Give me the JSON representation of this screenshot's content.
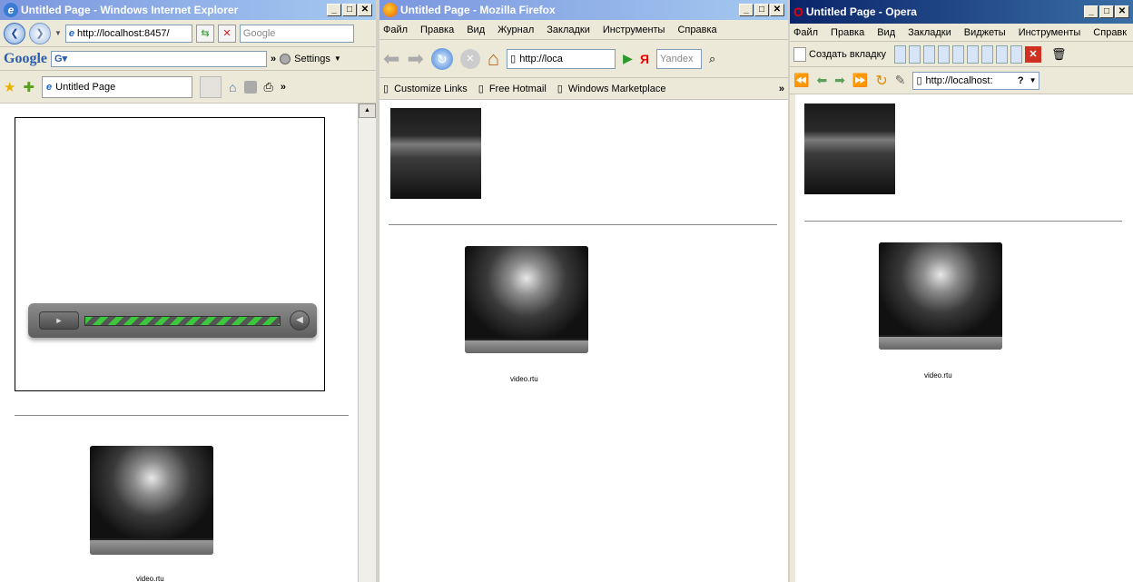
{
  "ie": {
    "title": "Untitled Page - Windows Internet Explorer",
    "address": "http://localhost:8457/",
    "search_placeholder": "Google",
    "google_logo": "Google",
    "settings_label": "Settings",
    "tab_label": "Untitled Page",
    "video_label": "video.rtu"
  },
  "firefox": {
    "title": "Untitled Page - Mozilla Firefox",
    "menu": [
      "Файл",
      "Правка",
      "Вид",
      "Журнал",
      "Закладки",
      "Инструменты",
      "Справка"
    ],
    "address": "http://loca",
    "search_placeholder": "Yandex",
    "bookmarks": [
      "Customize Links",
      "Free Hotmail",
      "Windows Marketplace"
    ],
    "video_label": "video.rtu"
  },
  "opera": {
    "title": "Untitled Page - Opera",
    "menu": [
      "Файл",
      "Правка",
      "Вид",
      "Закладки",
      "Виджеты",
      "Инструменты",
      "Справк"
    ],
    "new_tab_label": "Создать вкладку",
    "address": "http://localhost:",
    "video_label": "video.rtu"
  },
  "colors": {
    "titlebar_active": "#0a246a",
    "titlebar_inactive": "#7a96df",
    "progress_green": "#3cc83c"
  }
}
